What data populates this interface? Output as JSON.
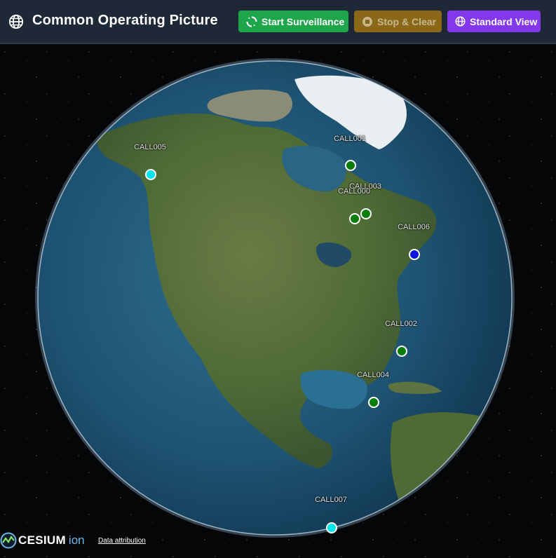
{
  "header": {
    "title": "Common Operating Picture",
    "buttons": {
      "start": "Start Surveillance",
      "stop": "Stop & Clear",
      "standard": "Standard View"
    }
  },
  "colors": {
    "header_bg": "#1e2836",
    "start": "#1fa64a",
    "stop": "#8a6818",
    "standard": "#8338ec",
    "marker_green": "#0a7d0a",
    "marker_blue": "#0a14e0",
    "marker_cyan": "#00e5f0"
  },
  "icons": {
    "logo": "globe-icon",
    "start": "radar-sync-icon",
    "stop": "stop-circle-icon",
    "standard": "globe-icon"
  },
  "markers": [
    {
      "label": "CALL001",
      "color": "green"
    },
    {
      "label": "CALL003",
      "color": "green"
    },
    {
      "label": "CALL000",
      "color": "green"
    },
    {
      "label": "CALL006",
      "color": "blue"
    },
    {
      "label": "CALL002",
      "color": "green"
    },
    {
      "label": "CALL004",
      "color": "green"
    },
    {
      "label": "CALL005",
      "color": "cyan"
    },
    {
      "label": "CALL007",
      "color": "cyan"
    }
  ],
  "footer": {
    "brand": "CESIUM",
    "brand_suffix": "ion",
    "attribution": "Data attribution"
  }
}
